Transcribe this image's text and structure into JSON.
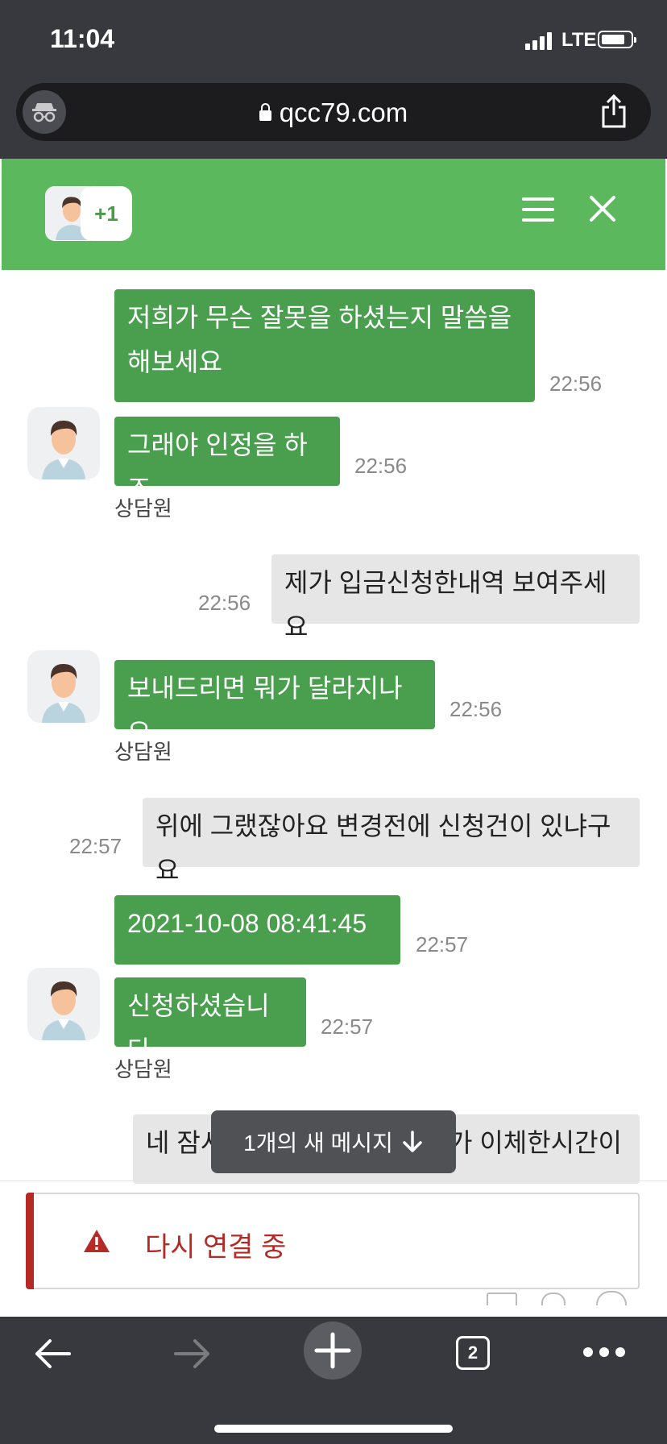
{
  "status_bar": {
    "time": "11:04",
    "network": "LTE"
  },
  "browser": {
    "url": "qcc79.com",
    "tab_count": "2"
  },
  "header": {
    "participants_extra": "+1"
  },
  "messages": [
    {
      "side": "agent",
      "text_line1": "저희가 무슨 잘못을 하셨는지 말씀을",
      "text_line2": "해보세요",
      "time": "22:56"
    },
    {
      "side": "agent",
      "text": "그래야 인정을 하죠",
      "time": "22:56",
      "sender": "상담원"
    },
    {
      "side": "user",
      "text": "제가 입금신청한내역 보여주세요",
      "time": "22:56"
    },
    {
      "side": "agent",
      "text": "보내드리면 뭐가 달라지나요",
      "time": "22:56",
      "sender": "상담원"
    },
    {
      "side": "user",
      "text": "위에 그랬잖아요 변경전에 신청건이 있냐구요",
      "time": "22:57"
    },
    {
      "side": "agent",
      "text": "2021-10-08 08:41:45",
      "time": "22:57"
    },
    {
      "side": "agent",
      "text": "신청하셨습니다",
      "time": "22:57",
      "sender": "상담원"
    },
    {
      "side": "user",
      "text_left": "네 잠시",
      "text_right": "가 이체한시간이"
    }
  ],
  "new_message_banner": "1개의 새 메시지",
  "reconnect_notice": "다시 연결 중",
  "colors": {
    "header_green": "#5cb85c",
    "agent_bubble": "#4a9f4e",
    "user_bubble": "#e6e6e6",
    "error_red": "#b52a25"
  }
}
